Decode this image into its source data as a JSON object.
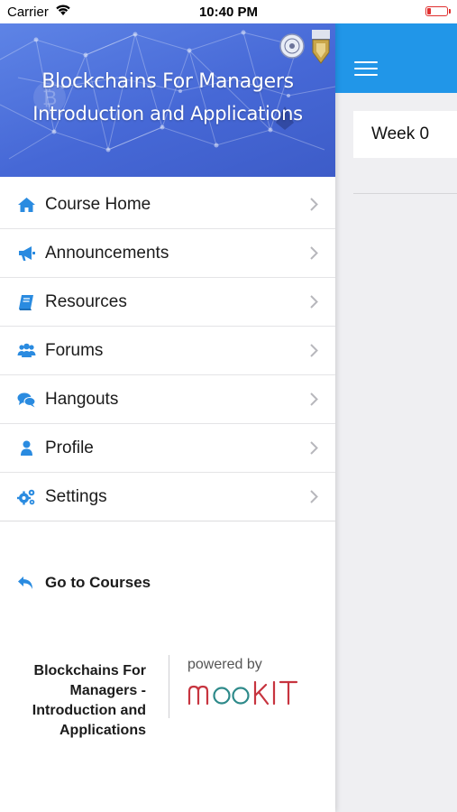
{
  "status_bar": {
    "carrier": "Carrier",
    "time": "10:40 PM",
    "battery_color": "#e0302f"
  },
  "banner": {
    "title_line1": "Blockchains For Managers",
    "title_line2": "Introduction and Applications"
  },
  "menu": {
    "items": [
      {
        "label": "Course Home",
        "icon": "home-icon"
      },
      {
        "label": "Announcements",
        "icon": "megaphone-icon"
      },
      {
        "label": "Resources",
        "icon": "book-icon"
      },
      {
        "label": "Forums",
        "icon": "users-icon"
      },
      {
        "label": "Hangouts",
        "icon": "chat-bubbles-icon"
      },
      {
        "label": "Profile",
        "icon": "user-icon"
      },
      {
        "label": "Settings",
        "icon": "gears-icon"
      }
    ]
  },
  "go_to_courses": {
    "label": "Go to Courses",
    "icon": "reply-arrow-icon"
  },
  "footer": {
    "course_name": "Blockchains For Managers - Introduction and Applications",
    "powered_by": "powered by",
    "brand": "mooKIT"
  },
  "main": {
    "week_label": "Week 0"
  },
  "colors": {
    "accent": "#2196e8",
    "icon_blue": "#2a8be0",
    "brand_red": "#c7343f",
    "brand_teal": "#2e8a8a"
  }
}
